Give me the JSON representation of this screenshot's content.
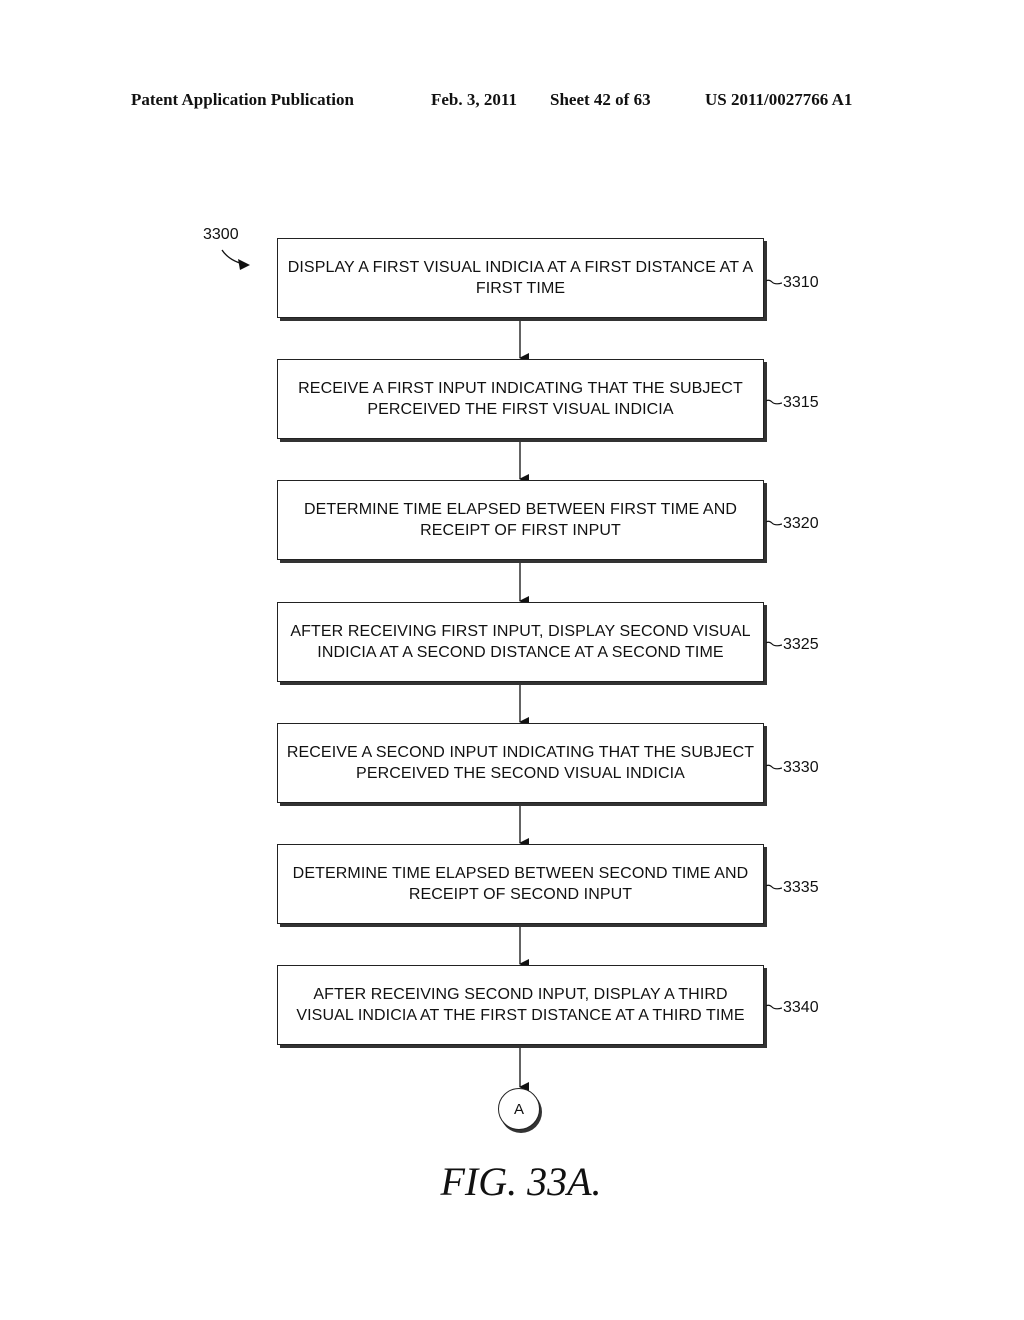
{
  "header": {
    "publication": "Patent Application Publication",
    "date": "Feb. 3, 2011",
    "sheet": "Sheet 42 of 63",
    "number": "US 2011/0027766 A1"
  },
  "diagram": {
    "reference": "3300",
    "steps": [
      {
        "id": "3310",
        "text": "DISPLAY A FIRST VISUAL INDICIA AT A FIRST DISTANCE AT A FIRST TIME"
      },
      {
        "id": "3315",
        "text": "RECEIVE A FIRST INPUT INDICATING THAT THE SUBJECT PERCEIVED THE FIRST VISUAL INDICIA"
      },
      {
        "id": "3320",
        "text": "DETERMINE TIME ELAPSED BETWEEN FIRST TIME AND RECEIPT OF FIRST INPUT"
      },
      {
        "id": "3325",
        "text": "AFTER RECEIVING FIRST INPUT, DISPLAY SECOND VISUAL INDICIA AT A SECOND DISTANCE AT A SECOND TIME"
      },
      {
        "id": "3330",
        "text": "RECEIVE A SECOND INPUT INDICATING THAT THE SUBJECT PERCEIVED THE SECOND VISUAL INDICIA"
      },
      {
        "id": "3335",
        "text": "DETERMINE TIME ELAPSED BETWEEN SECOND TIME AND RECEIPT OF SECOND INPUT"
      },
      {
        "id": "3340",
        "text": "AFTER RECEIVING SECOND INPUT, DISPLAY A THIRD VISUAL INDICIA AT THE FIRST DISTANCE AT A THIRD TIME"
      }
    ],
    "connector": "A",
    "caption": "FIG. 33A."
  }
}
